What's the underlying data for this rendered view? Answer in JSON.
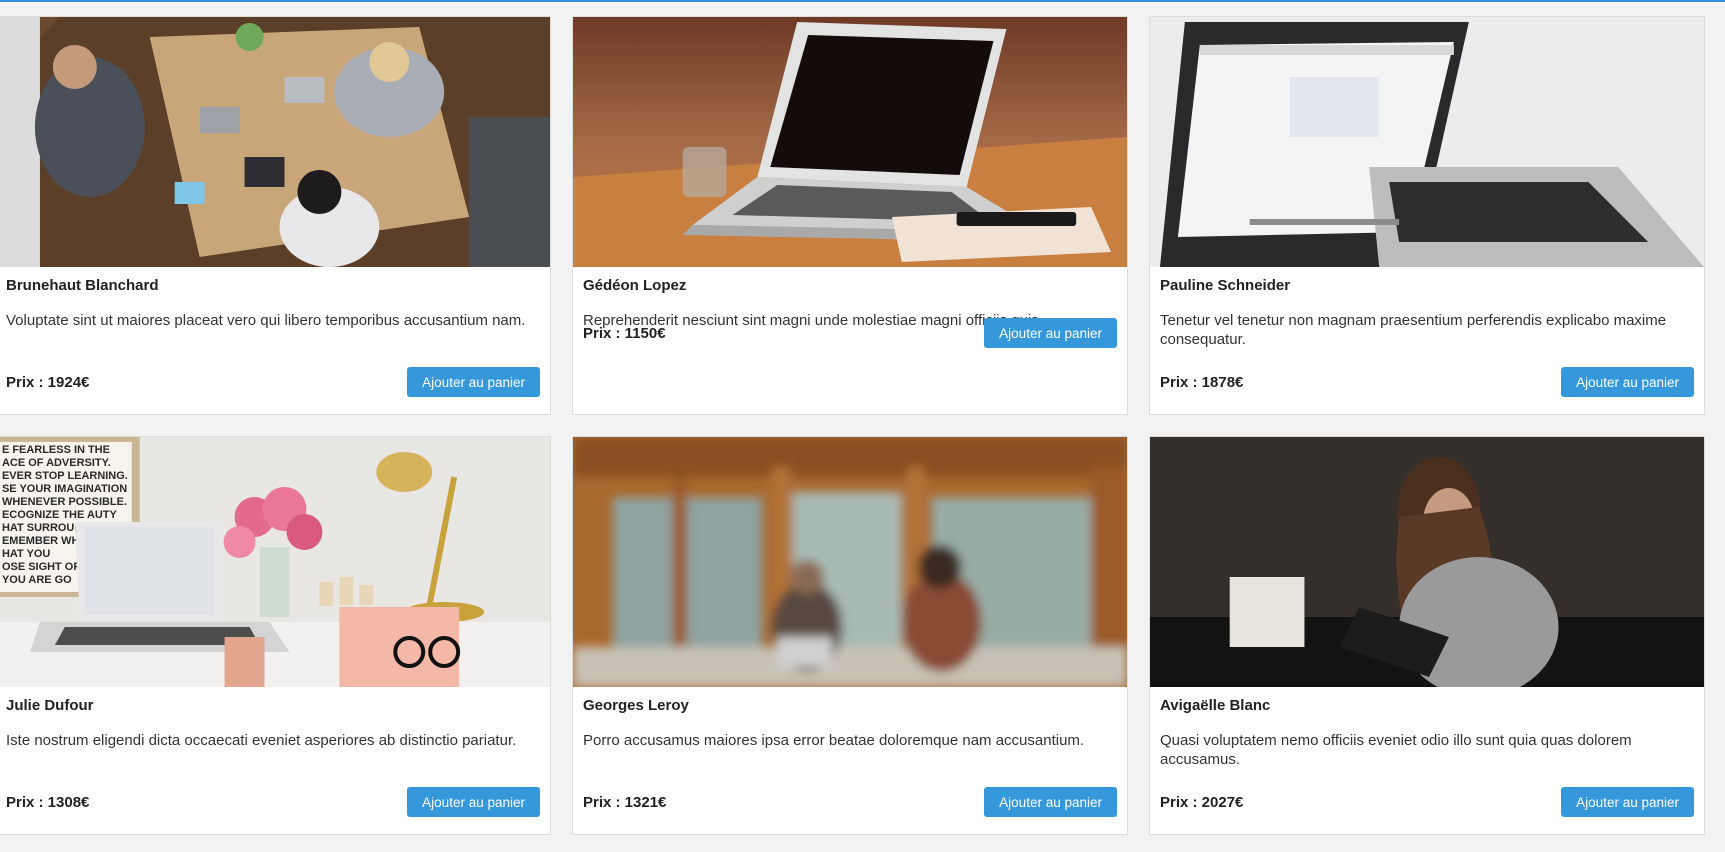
{
  "products": [
    {
      "name": "Brunehaut Blanchard",
      "description": "Voluptate sint ut maiores placeat vero qui libero temporibus accusantium nam.",
      "price": "Prix : 1924€",
      "button": "Ajouter au panier",
      "image": "office-meeting-photo"
    },
    {
      "name": "Gédéon Lopez",
      "description": "Reprehenderit nesciunt sint magni unde molestiae magni officiis quis.",
      "price": "Prix : 1150€",
      "button": "Ajouter au panier",
      "image": "laptop-on-desk-photo"
    },
    {
      "name": "Pauline Schneider",
      "description": "Tenetur vel tenetur non magnam praesentium perferendis explicabo maxime consequatur.",
      "price": "Prix : 1878€",
      "button": "Ajouter au panier",
      "image": "white-laptop-photo"
    },
    {
      "name": "Julie Dufour",
      "description": "Iste nostrum eligendi dicta occaecati eveniet asperiores ab distinctio pariatur.",
      "price": "Prix : 1308€",
      "button": "Ajouter au panier",
      "image": "desk-flowers-laptop-photo"
    },
    {
      "name": "Georges Leroy",
      "description": "Porro accusamus maiores ipsa error beatae doloremque nam accusantium.",
      "price": "Prix : 1321€",
      "button": "Ajouter au panier",
      "image": "blurred-cafe-photo"
    },
    {
      "name": "Avigaëlle Blanc",
      "description": "Quasi voluptatem nemo officiis eveniet odio illo sunt quia quas dolorem accusamus.",
      "price": "Prix : 2027€",
      "button": "Ajouter au panier",
      "image": "woman-tablet-photo"
    }
  ],
  "poster_text": "E FEARLESS IN THE\nACE OF ADVERSITY.\nEVER STOP LEARNING.\nSE YOUR IMAGINATION\nWHENEVER POSSIBLE.\nECOGNIZE THE AUTY\nHAT SURROUN\nEMEMBER WH\nHAT YOU\nOSE SIGHT OF\nYOU ARE GO",
  "colors": {
    "accent": "#3498db",
    "topbar": "#2f8fd8",
    "background": "#f2f2f2"
  }
}
